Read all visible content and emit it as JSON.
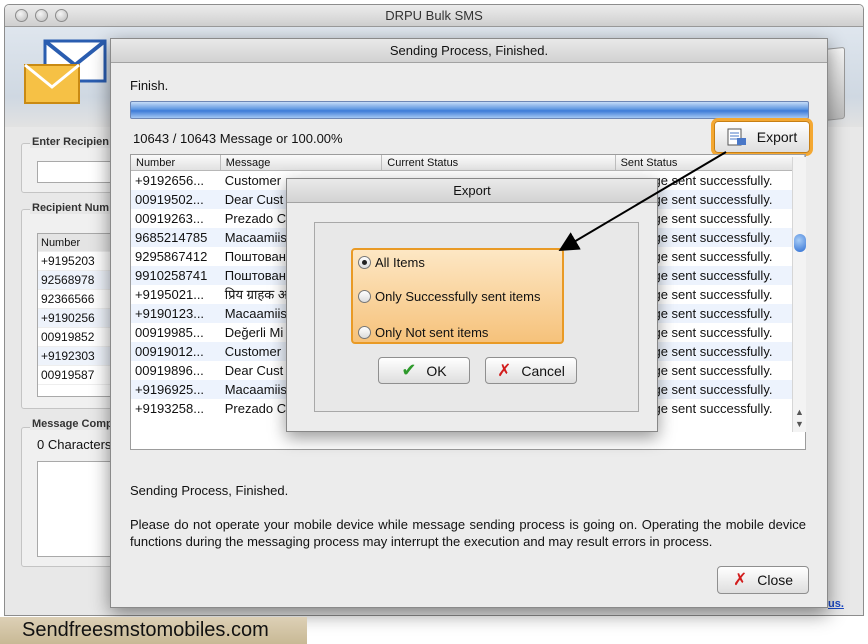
{
  "window": {
    "title": "DRPU Bulk SMS"
  },
  "background": {
    "enter_recipient_label": "Enter Recipien",
    "recipient_number_label": "Recipient Num",
    "number_header": "Number",
    "numbers": [
      "+9195203",
      "92568978",
      "92366566",
      "+9190256",
      "00919852",
      "+9192303",
      "00919587"
    ],
    "message_composer_label": "Message Comp",
    "characters_label": "0 Characters",
    "link_fragment": "us."
  },
  "sheet": {
    "title": "Sending Process, Finished.",
    "finish_label": "Finish.",
    "progress": 1.0,
    "count_text": "10643 / 10643 Message or 100.00%",
    "export_label": "Export",
    "columns": [
      "Number",
      "Message",
      "Current Status",
      "Sent Status"
    ],
    "rows": [
      [
        "+9192656...",
        "Customer",
        "",
        "ge sent successfully."
      ],
      [
        "00919502...",
        "Dear Cust",
        "",
        "ge sent successfully."
      ],
      [
        "00919263...",
        "Prezado C",
        "",
        "ge sent successfully."
      ],
      [
        "9685214785",
        "Macaamiis",
        "",
        "ge sent successfully."
      ],
      [
        "9295867412",
        "Поштован",
        "",
        "ge sent successfully."
      ],
      [
        "9910258741",
        "Поштован",
        "",
        "ge sent successfully."
      ],
      [
        "+9195021...",
        "प्रिय ग्राहक अ",
        "",
        "ge sent successfully."
      ],
      [
        "+9190123...",
        "Macaamiis",
        "",
        "ge sent successfully."
      ],
      [
        "00919985...",
        "Değerli Mi",
        "",
        "ge sent successfully."
      ],
      [
        "00919012...",
        "Customer",
        "",
        "ge sent successfully."
      ],
      [
        "00919896...",
        "Dear Cust",
        "",
        "ge sent successfully."
      ],
      [
        "+9196925...",
        "Macaamiis",
        "",
        "ge sent successfully."
      ],
      [
        "+9193258...",
        "Prezado C",
        "",
        "ge sent successfully."
      ]
    ],
    "status_text": "Sending Process, Finished.",
    "warning_text": "Please do not operate your mobile device while message sending process is going on. Operating the mobile device functions during the messaging process may interrupt the execution and may result errors in process.",
    "close_label": "Close"
  },
  "export_dialog": {
    "title": "Export",
    "options": [
      "All Items",
      "Only Successfully sent items",
      "Only Not sent items"
    ],
    "selected": 0,
    "ok_label": "OK",
    "cancel_label": "Cancel"
  },
  "watermark": "Sendfreesmstomobiles.com",
  "colors": {
    "highlight": "#f4a832",
    "progress": "#3d7bd8",
    "ok": "#2e9a2c",
    "cancel": "#d21d1d"
  }
}
